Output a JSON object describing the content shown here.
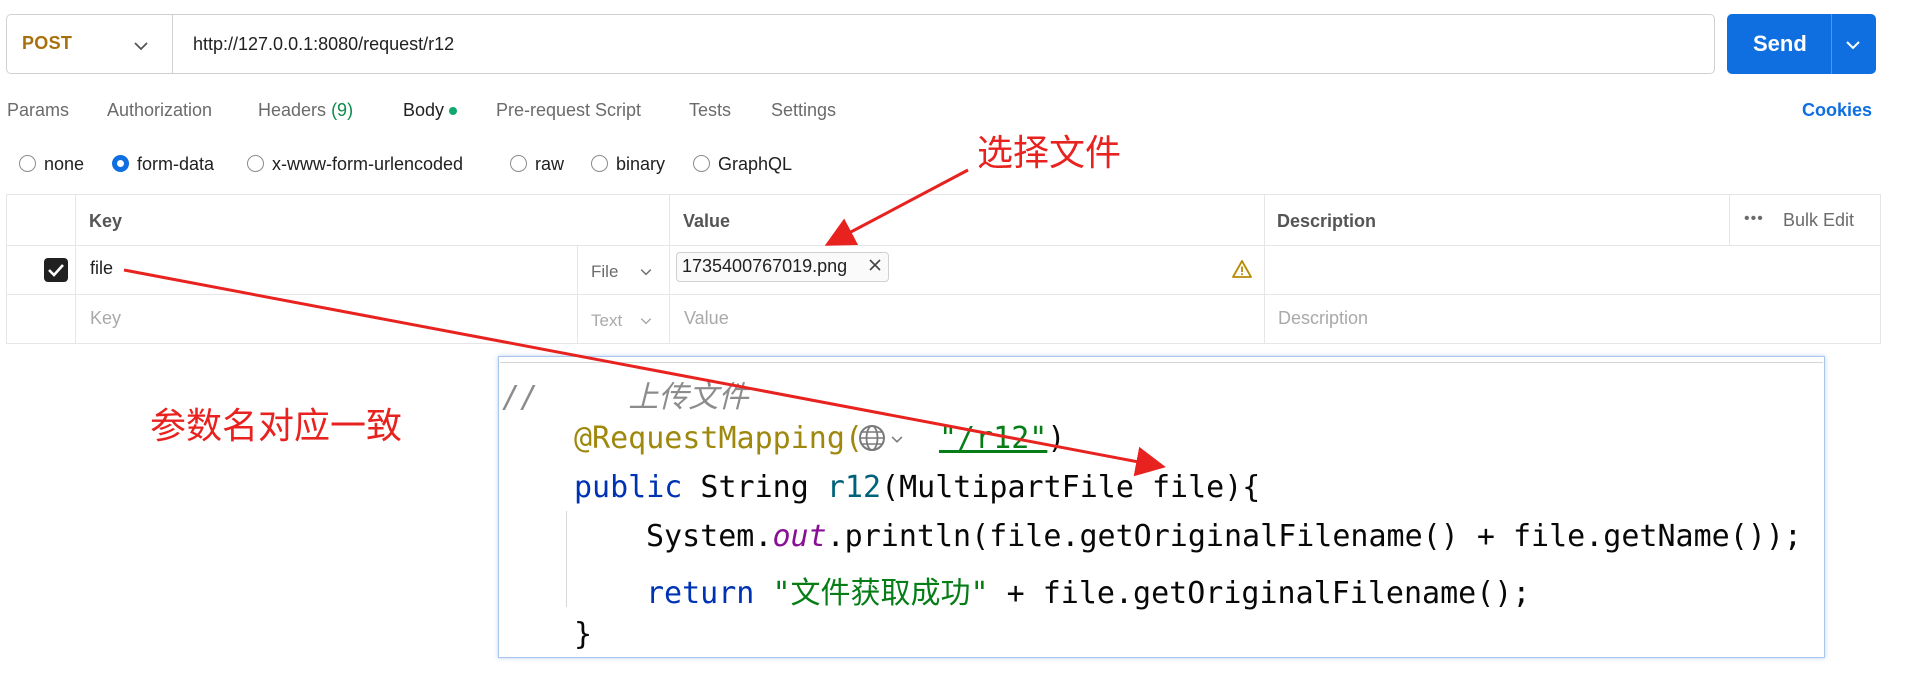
{
  "request": {
    "method": "POST",
    "url": "http://127.0.0.1:8080/request/r12",
    "send_label": "Send"
  },
  "tabs": {
    "params": "Params",
    "authorization": "Authorization",
    "headers": "Headers",
    "headers_count": "(9)",
    "body": "Body",
    "prerequest": "Pre-request Script",
    "tests": "Tests",
    "settings": "Settings",
    "cookies": "Cookies"
  },
  "body_modes": {
    "none": "none",
    "form_data": "form-data",
    "urlencoded": "x-www-form-urlencoded",
    "raw": "raw",
    "binary": "binary",
    "graphql": "GraphQL",
    "selected": "form-data"
  },
  "table": {
    "headers": {
      "key": "Key",
      "value": "Value",
      "description": "Description",
      "bulk_edit": "Bulk Edit"
    },
    "rows": [
      {
        "key": "file",
        "type": "File",
        "value": "1735400767019.png",
        "checked": true
      }
    ],
    "new_row": {
      "key_placeholder": "Key",
      "type": "Text",
      "value_placeholder": "Value",
      "description_placeholder": "Description"
    }
  },
  "code": {
    "line1_comment": "//     上传文件",
    "line2_annotation": "@RequestMapping(",
    "line2_string": "\"/r12\"",
    "line2_close": ")",
    "line3_kw": "public",
    "line3_type": " String ",
    "line3_name": "r12",
    "line3_rest": "(MultipartFile file){",
    "line4_a": "System.",
    "line4_field": "out",
    "line4_b": ".println(file.getOriginalFilename() + file.getName());",
    "line5_kw": "return",
    "line5_string": "\"文件获取成功\"",
    "line5_rest": " + file.getOriginalFilename();",
    "line6": "}"
  },
  "annotations": {
    "select_file": "选择文件",
    "param_name_match": "参数名对应一致"
  },
  "colors": {
    "accent": "#0f6fe0",
    "method": "#a8700a",
    "annotation_red": "#e8221f"
  }
}
